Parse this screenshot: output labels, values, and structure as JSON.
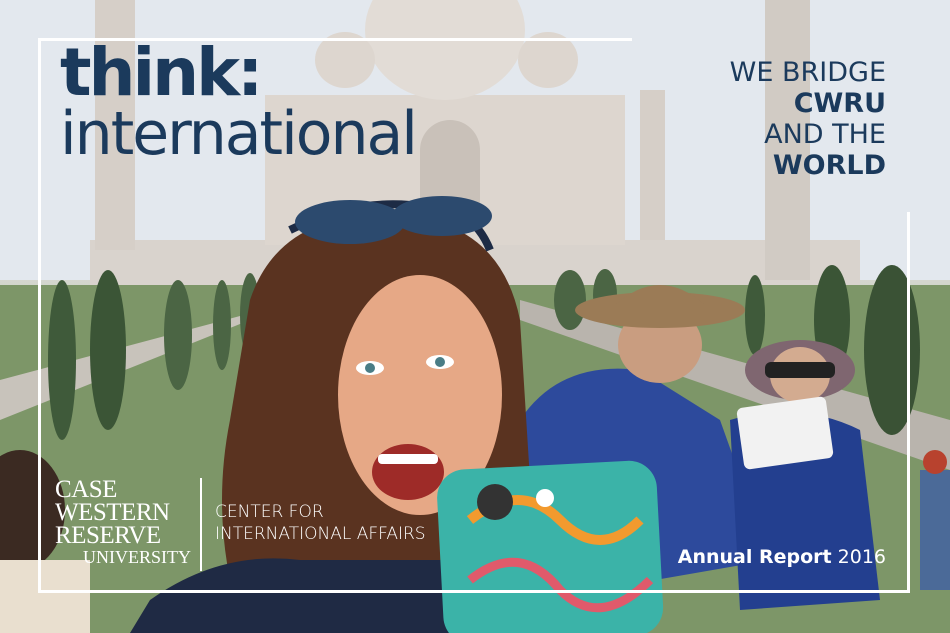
{
  "title": {
    "line1": "think:",
    "line2": "international"
  },
  "tagline": {
    "line1": "WE BRIDGE",
    "line2": "CWRU",
    "line3": "AND THE",
    "line4": "WORLD"
  },
  "logo": {
    "line1": "CASE",
    "line2": "WESTERN",
    "line3": "RESERVE",
    "line4": "UNIVERSITY"
  },
  "department": {
    "line1": "CENTER FOR",
    "line2": "INTERNATIONAL AFFAIRS"
  },
  "report": {
    "label": "Annual Report",
    "year": "2016"
  },
  "colors": {
    "title_navy": "#1b3a5c",
    "frame_white": "#ffffff"
  }
}
